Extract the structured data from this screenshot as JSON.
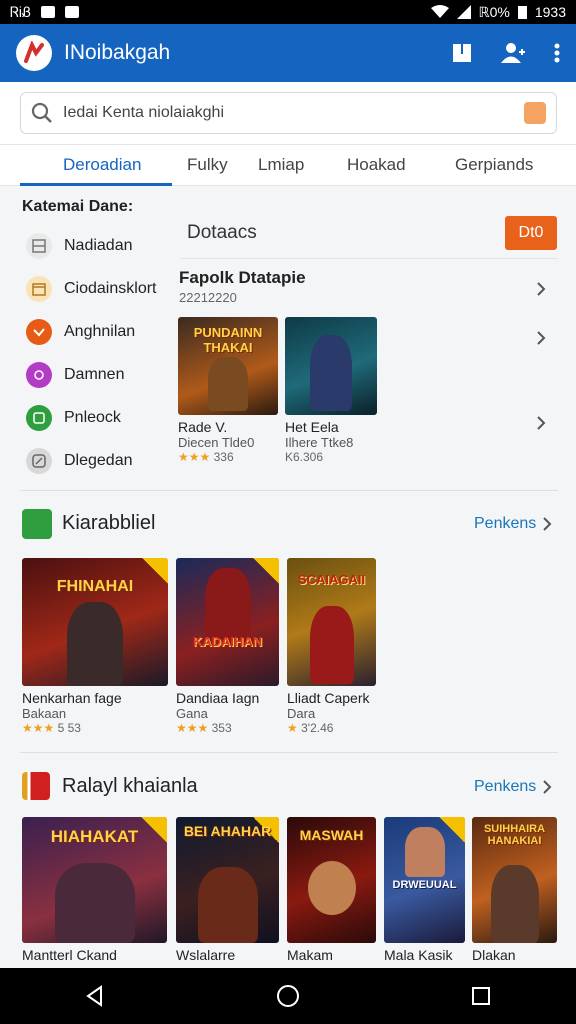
{
  "statusbar": {
    "left_text": "ᏒᎥᏰ",
    "battery": "ℝ0%",
    "time": "1933"
  },
  "appbar": {
    "title": "INoibakgah",
    "icons": [
      "logo-icon",
      "bookmark-icon",
      "account-icon",
      "more-icon"
    ]
  },
  "search": {
    "placeholder": "Iedai Kenta niolaiakghi"
  },
  "tabs": [
    {
      "label": "Deroadian",
      "active": true
    },
    {
      "label": "Fulky"
    },
    {
      "label": "Lmiap"
    },
    {
      "label": "Hoakad"
    },
    {
      "label": "Gerpiands"
    }
  ],
  "categories": {
    "title": "Katemai Dane:",
    "items": [
      {
        "label": "Nadiadan",
        "icon": "grid-icon",
        "color": "#8a8a8a"
      },
      {
        "label": "Ciodainsklort",
        "icon": "calendar-icon",
        "color": "#c08a30"
      },
      {
        "label": "Anghnilan",
        "icon": "puzzle-icon",
        "color": "#e65c17"
      },
      {
        "label": "Damnen",
        "icon": "sparkle-icon",
        "color": "#b43cc4"
      },
      {
        "label": "Pnleock",
        "icon": "square-icon",
        "color": "#2e9e3e"
      },
      {
        "label": "Dlegedan",
        "icon": "gauge-icon",
        "color": "#8c8c8c"
      }
    ]
  },
  "panel": {
    "title": "Dotaacs",
    "button": "Dt0",
    "subhead": "Fapolk Dtatapie",
    "subnum": "22212220",
    "cards": [
      {
        "art": "PUNDAINN THAKAI",
        "name": "Rade V.",
        "sub": "Diecen Tlde0",
        "stars": "★★★",
        "rating": "336"
      },
      {
        "art": "",
        "name": "Het Eela",
        "sub": "Ilhere Ttke8",
        "stars": "",
        "rating": "K6.306"
      }
    ]
  },
  "section1": {
    "title": "Kiarabbliel",
    "more": "Penkens",
    "icon": "android-icon",
    "cards": [
      {
        "art": "FHINAHAI",
        "name": "Nenkarhan fage",
        "sub": "Bakaan",
        "stars": "★★★",
        "rating": "5 53"
      },
      {
        "art": "KADAIHAN",
        "name": "Dandiaa Iagn",
        "sub": "Gana",
        "stars": "★★★",
        "rating": "353"
      },
      {
        "art": "SCAIAGAII",
        "name": "Lliadt Caperk",
        "sub": "Dara",
        "stars": "★",
        "rating": "3'2.46"
      }
    ]
  },
  "section2": {
    "title": "Ralayl khaianla",
    "more": "Penkens",
    "icon": "flag-icon",
    "cards": [
      {
        "art": "HIAHAKAT",
        "name": "Mantterl Ckand"
      },
      {
        "art": "BEI AHAHAR",
        "name": "Wslalarre"
      },
      {
        "art": "MASWAH",
        "name": "Makam"
      },
      {
        "art": "DRWEUUAL",
        "name": "Mala Kasik"
      },
      {
        "art": "SUIHHAIRA HANAKIAI",
        "name": "Dlakan"
      }
    ]
  },
  "colors": {
    "primary": "#1565c0",
    "accent": "#e8621c",
    "link": "#1976b8"
  }
}
